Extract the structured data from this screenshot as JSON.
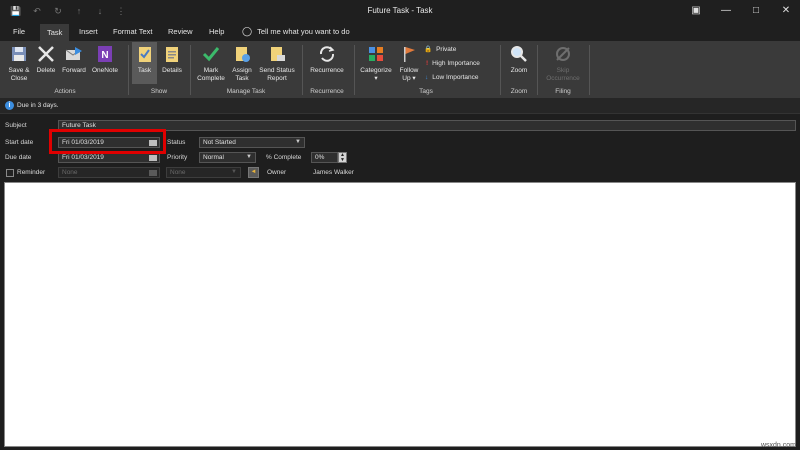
{
  "window": {
    "title": "Future Task  -  Task"
  },
  "tabs": [
    "File",
    "Task",
    "Insert",
    "Format Text",
    "Review",
    "Help"
  ],
  "tell_me": "Tell me what you want to do",
  "ribbon": {
    "actions": {
      "label": "Actions",
      "save_close": [
        "Save &",
        "Close"
      ],
      "delete": "Delete",
      "forward": "Forward",
      "onenote": "OneNote"
    },
    "show": {
      "label": "Show",
      "task": "Task",
      "details": "Details"
    },
    "manage_task": {
      "label": "Manage Task",
      "mark_complete": [
        "Mark",
        "Complete"
      ],
      "assign_task": [
        "Assign",
        "Task"
      ],
      "send_status": [
        "Send Status",
        "Report"
      ]
    },
    "recurrence": {
      "label": "Recurrence",
      "recurrence": "Recurrence"
    },
    "tags": {
      "label": "Tags",
      "categorize": "Categorize",
      "follow_up": [
        "Follow",
        "Up"
      ],
      "private": "Private",
      "high_importance": "High Importance",
      "low_importance": "Low Importance"
    },
    "zoom": {
      "label": "Zoom",
      "zoom": "Zoom"
    },
    "filing": {
      "label": "Filing",
      "skip": [
        "Skip",
        "Occurrence"
      ]
    }
  },
  "info_bar": "Due in 3 days.",
  "form": {
    "subject_label": "Subject",
    "subject_value": "Future Task",
    "start_date_label": "Start date",
    "start_date_value": "Fri 01/03/2019",
    "due_date_label": "Due date",
    "due_date_value": "Fri 01/03/2019",
    "status_label": "Status",
    "status_value": "Not Started",
    "priority_label": "Priority",
    "priority_value": "Normal",
    "percent_label": "% Complete",
    "percent_value": "0%",
    "reminder_label": "Reminder",
    "reminder_date": "None",
    "reminder_time": "None",
    "owner_label": "Owner",
    "owner_value": "James Walker"
  },
  "watermark": "wsxdn.com"
}
